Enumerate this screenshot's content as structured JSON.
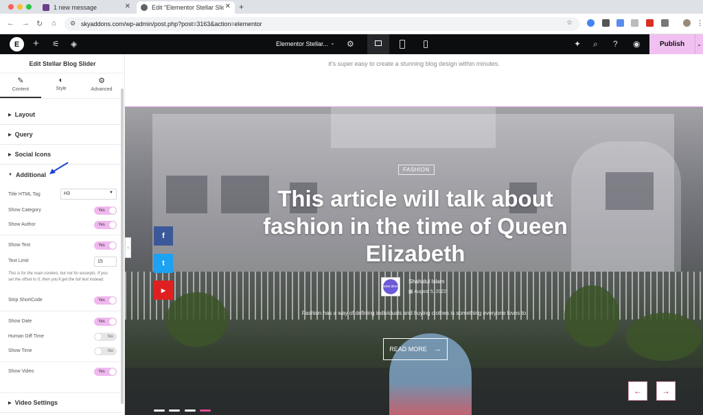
{
  "browser": {
    "tabs": [
      {
        "label": "1 new message"
      },
      {
        "label": "Edit “Elementor Stellar Slide"
      }
    ],
    "url": "skyaddons.com/wp-admin/post.php?post=3163&action=elementor",
    "new_tab": "+",
    "close": "✕"
  },
  "editor": {
    "page_title": "Elementor Stellar...",
    "publish_label": "Publish"
  },
  "panel": {
    "title": "Edit Stellar Blog Slider",
    "tabs": [
      {
        "label": "Content",
        "icon": "✎"
      },
      {
        "label": "Style",
        "icon": "◐"
      },
      {
        "label": "Advanced",
        "icon": "⚙"
      }
    ],
    "sections": {
      "layout": "Layout",
      "query": "Query",
      "social_icons": "Social Icons",
      "additional": "Additional",
      "video_settings": "Video Settings"
    },
    "controls": {
      "title_html_tag": {
        "label": "Title HTML Tag",
        "value": "H3"
      },
      "show_category": {
        "label": "Show Category",
        "value": "Yes"
      },
      "show_author": {
        "label": "Show Author",
        "value": "Yes"
      },
      "show_text": {
        "label": "Show Text",
        "value": "Yes"
      },
      "text_limit": {
        "label": "Text Limit",
        "value": "15"
      },
      "text_limit_help": "This is for the main content, but not for excerpts. If you set the offset to 0, then you'll get the full text instead.",
      "strip_shortcode": {
        "label": "Strip ShortCode",
        "value": "Yes"
      },
      "show_date": {
        "label": "Show Date",
        "value": "Yes"
      },
      "human_diff_time": {
        "label": "Human Diff Time",
        "value": "No"
      },
      "show_time": {
        "label": "Show Time",
        "value": "No"
      },
      "show_video": {
        "label": "Show Video",
        "value": "Yes"
      }
    }
  },
  "canvas": {
    "intro_text": "it’s super easy to create a stunning blog design within minutes.",
    "slide": {
      "category": "FASHION",
      "title": "This article will talk about fashion in the time of Queen Elizabeth",
      "author": "Shahidul Islam",
      "date": "August 5, 2022",
      "excerpt": "Fashion has a way of defining individuals and buying clothes is something everyone loves to",
      "read_more": "READ MORE",
      "avatar_text": "wow devs"
    },
    "social": [
      "f",
      "t",
      "▶"
    ],
    "colors": {
      "accent": "#f0b8ee",
      "facebook": "#3b5998",
      "twitter": "#1da1f2",
      "youtube": "#e02020"
    }
  }
}
